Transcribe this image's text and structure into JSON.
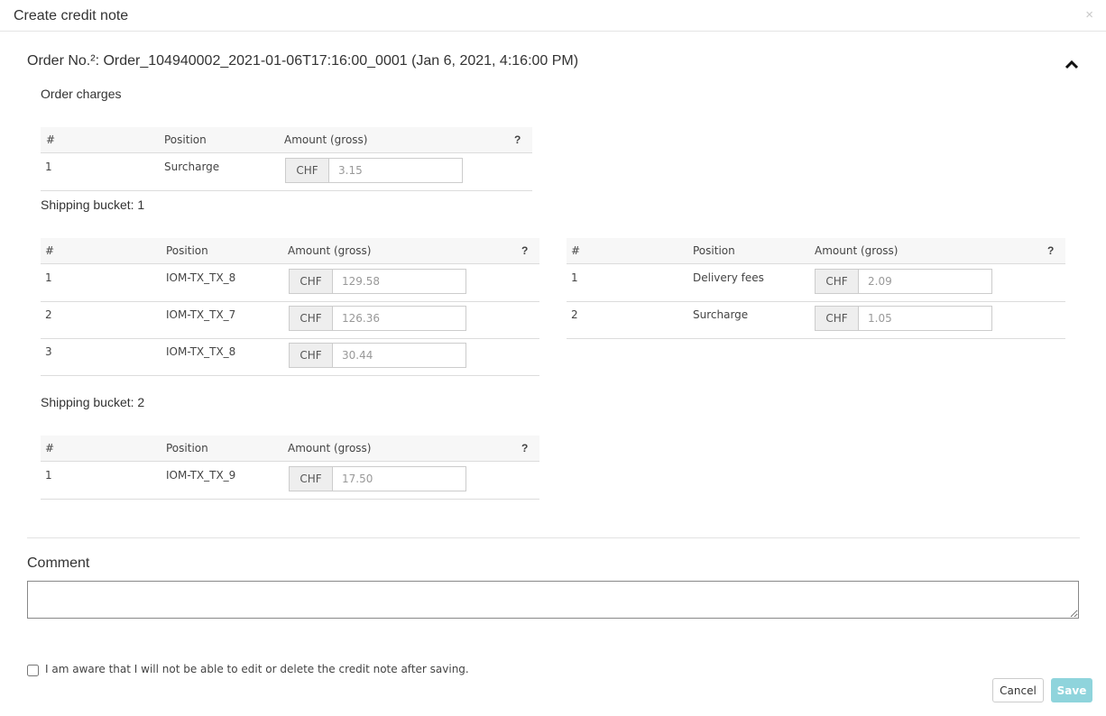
{
  "modal": {
    "title": "Create credit note",
    "close_glyph": "×"
  },
  "order": {
    "title": "Order No.²: Order_104940002_2021-01-06T17:16:00_0001 (Jan 6, 2021, 4:16:00 PM)"
  },
  "columns": {
    "num": "#",
    "position": "Position",
    "amount": "Amount (gross)",
    "help": "?"
  },
  "order_charges": {
    "label": "Order charges",
    "rows": [
      {
        "num": "1",
        "position": "Surcharge",
        "currency": "CHF",
        "value": "3.15"
      }
    ]
  },
  "bucket1": {
    "label": "Shipping bucket: 1",
    "items": [
      {
        "num": "1",
        "position": "IOM-TX_TX_8",
        "currency": "CHF",
        "value": "129.58"
      },
      {
        "num": "2",
        "position": "IOM-TX_TX_7",
        "currency": "CHF",
        "value": "126.36"
      },
      {
        "num": "3",
        "position": "IOM-TX_TX_8",
        "currency": "CHF",
        "value": "30.44"
      }
    ],
    "charges": [
      {
        "num": "1",
        "position": "Delivery fees",
        "currency": "CHF",
        "value": "2.09"
      },
      {
        "num": "2",
        "position": "Surcharge",
        "currency": "CHF",
        "value": "1.05"
      }
    ]
  },
  "bucket2": {
    "label": "Shipping bucket: 2",
    "items": [
      {
        "num": "1",
        "position": "IOM-TX_TX_9",
        "currency": "CHF",
        "value": "17.50"
      }
    ]
  },
  "comment": {
    "label": "Comment",
    "value": ""
  },
  "confirm": {
    "label": "I am aware that I will not be able to edit or delete the credit note after saving.",
    "checked": false
  },
  "buttons": {
    "cancel": "Cancel",
    "save": "Save"
  },
  "colors": {
    "save_bg": "#8fd4dc",
    "header_bg": "#f7f7f7"
  }
}
